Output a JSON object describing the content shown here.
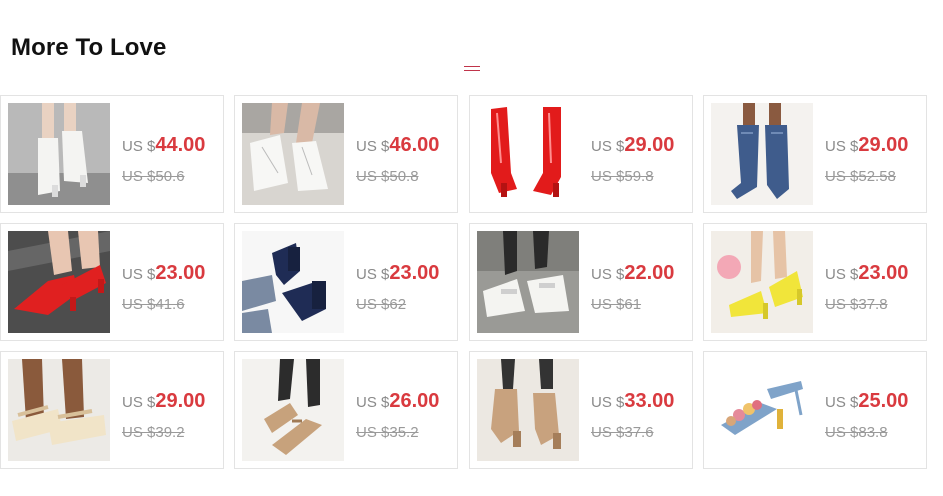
{
  "section": {
    "title": "More To Love"
  },
  "colors": {
    "price": "#d93a3f",
    "old_price": "#9a9a9a",
    "accent_mark": "#c0344a"
  },
  "products": [
    {
      "currency": "US $",
      "price": "44.00",
      "old_price": "US $50.6",
      "image": "white-ankle-boots"
    },
    {
      "currency": "US $",
      "price": "46.00",
      "old_price": "US $50.8",
      "image": "white-lace-up-ankle-boots"
    },
    {
      "currency": "US $",
      "price": "29.00",
      "old_price": "US $59.8",
      "image": "red-knee-high-boots"
    },
    {
      "currency": "US $",
      "price": "29.00",
      "old_price": "US $52.58",
      "image": "blue-denim-knee-boots"
    },
    {
      "currency": "US $",
      "price": "23.00",
      "old_price": "US $41.6",
      "image": "red-patent-pumps"
    },
    {
      "currency": "US $",
      "price": "23.00",
      "old_price": "US $62",
      "image": "navy-platform-heels"
    },
    {
      "currency": "US $",
      "price": "22.00",
      "old_price": "US $61",
      "image": "white-mary-jane-platforms"
    },
    {
      "currency": "US $",
      "price": "23.00",
      "old_price": "US $37.8",
      "image": "yellow-mary-jane-heels"
    },
    {
      "currency": "US $",
      "price": "29.00",
      "old_price": "US $39.2",
      "image": "beige-platform-sandals"
    },
    {
      "currency": "US $",
      "price": "26.00",
      "old_price": "US $35.2",
      "image": "tan-flat-sandals"
    },
    {
      "currency": "US $",
      "price": "33.00",
      "old_price": "US $37.6",
      "image": "tan-block-heel-sandals"
    },
    {
      "currency": "US $",
      "price": "25.00",
      "old_price": "US $83.8",
      "image": "flower-heel-sandals"
    }
  ]
}
